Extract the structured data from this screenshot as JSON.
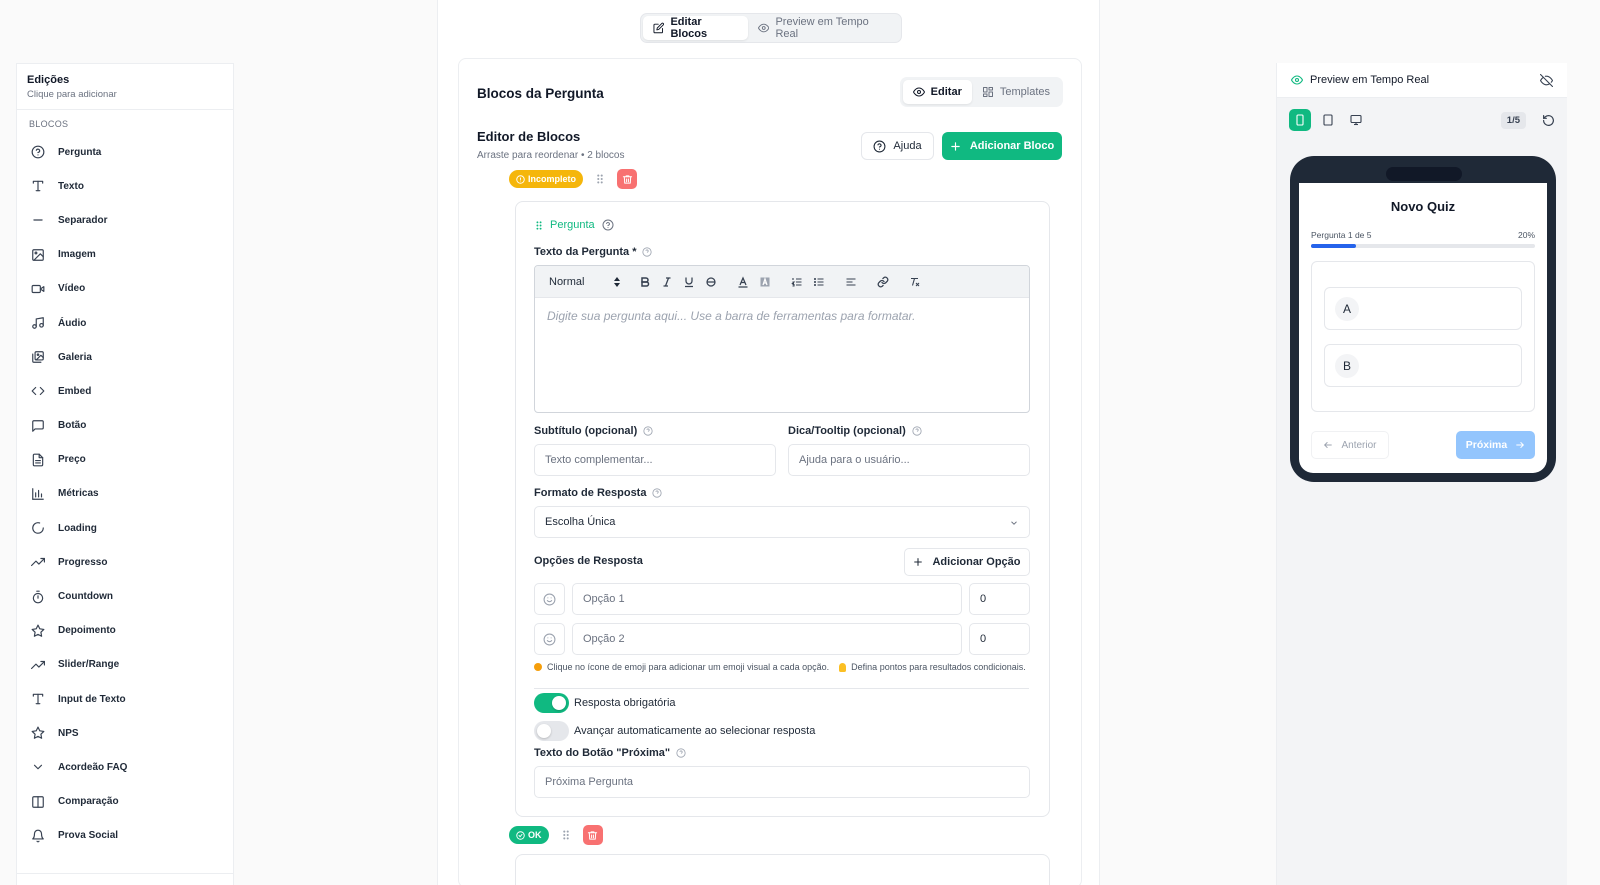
{
  "sidebar": {
    "title": "Edições",
    "subtitle": "Clique para adicionar",
    "section": "BLOCOS",
    "items": [
      {
        "label": "Pergunta",
        "icon": "help-circle-icon"
      },
      {
        "label": "Texto",
        "icon": "text-icon"
      },
      {
        "label": "Separador",
        "icon": "minus-icon"
      },
      {
        "label": "Imagem",
        "icon": "image-icon"
      },
      {
        "label": "Vídeo",
        "icon": "video-icon"
      },
      {
        "label": "Áudio",
        "icon": "music-icon"
      },
      {
        "label": "Galeria",
        "icon": "gallery-icon"
      },
      {
        "label": "Embed",
        "icon": "code-icon"
      },
      {
        "label": "Botão",
        "icon": "message-square-icon"
      },
      {
        "label": "Preço",
        "icon": "file-text-icon"
      },
      {
        "label": "Métricas",
        "icon": "bar-chart-icon"
      },
      {
        "label": "Loading",
        "icon": "loader-icon"
      },
      {
        "label": "Progresso",
        "icon": "trending-up-icon"
      },
      {
        "label": "Countdown",
        "icon": "timer-icon"
      },
      {
        "label": "Depoimento",
        "icon": "star-icon"
      },
      {
        "label": "Slider/Range",
        "icon": "trending-up-icon"
      },
      {
        "label": "Input de Texto",
        "icon": "text-icon"
      },
      {
        "label": "NPS",
        "icon": "star-icon"
      },
      {
        "label": "Acordeão FAQ",
        "icon": "chevron-down-icon"
      },
      {
        "label": "Comparação",
        "icon": "columns-icon"
      },
      {
        "label": "Prova Social",
        "icon": "bell-icon"
      }
    ]
  },
  "top_tabs": {
    "edit": "Editar Blocos",
    "preview": "Preview em Tempo Real"
  },
  "panel": {
    "title": "Blocos da Pergunta",
    "tab_edit": "Editar",
    "tab_templates": "Templates",
    "editor_title": "Editor de Blocos",
    "editor_subtitle": "Arraste para reordenar • 2 blocos",
    "help_button": "Ajuda",
    "add_block_button": "Adicionar Bloco"
  },
  "block1": {
    "status": "Incompleto",
    "type_label": "Pergunta",
    "question_label": "Texto da Pergunta *",
    "format_select": "Normal",
    "editor_placeholder": "Digite sua pergunta aqui... Use a barra de ferramentas para formatar.",
    "subtitle_label": "Subtítulo (opcional)",
    "subtitle_placeholder": "Texto complementar...",
    "tooltip_label": "Dica/Tooltip (opcional)",
    "tooltip_placeholder": "Ajuda para o usuário...",
    "answer_format_label": "Formato de Resposta",
    "answer_format_value": "Escolha Única",
    "options_label": "Opções de Resposta",
    "add_option_button": "Adicionar Opção",
    "options": [
      {
        "placeholder": "Opção 1",
        "points": "0"
      },
      {
        "placeholder": "Opção 2",
        "points": "0"
      }
    ],
    "hint_emoji": "Clique no ícone de emoji para adicionar um emoji visual a cada opção.",
    "hint_points": "Defina pontos para resultados condicionais.",
    "required_label": "Resposta obrigatória",
    "required_on": true,
    "auto_advance_label": "Avançar automaticamente ao selecionar resposta",
    "auto_advance_on": false,
    "next_button_label": "Texto do Botão \"Próxima\"",
    "next_button_placeholder": "Próxima Pergunta"
  },
  "block2": {
    "status": "OK"
  },
  "preview": {
    "title": "Preview em Tempo Real",
    "page_count": "1/5",
    "quiz_title": "Novo Quiz",
    "progress_label": "Pergunta 1 de 5",
    "progress_pct": "20%",
    "progress_value": 0.2,
    "options": [
      "A",
      "B"
    ],
    "prev_button": "Anterior",
    "next_button": "Próxima"
  },
  "colors": {
    "accent": "#10b981",
    "warning": "#f5b60b",
    "danger": "#f87171",
    "progress": "#2563eb"
  }
}
